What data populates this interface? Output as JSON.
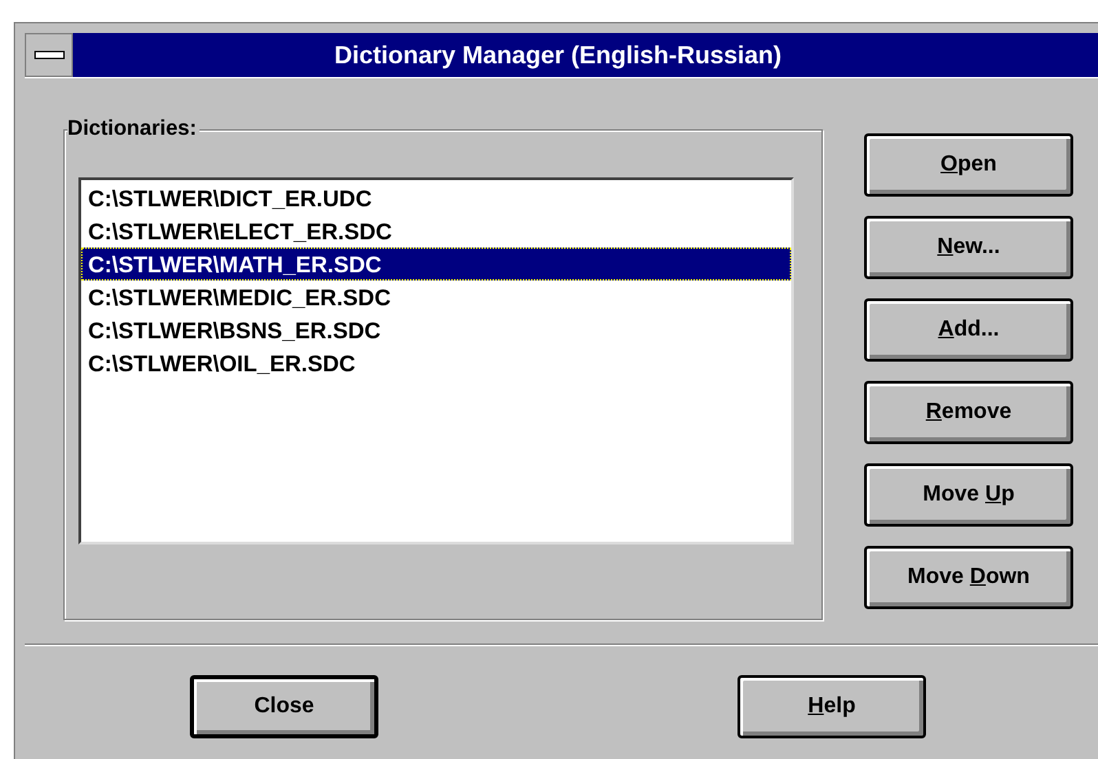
{
  "window": {
    "title": "Dictionary Manager (English-Russian)"
  },
  "dictionaries": {
    "label": "Dictionaries:",
    "items": [
      {
        "text": "C:\\STLWER\\DICT_ER.UDC",
        "selected": false
      },
      {
        "text": "C:\\STLWER\\ELECT_ER.SDC",
        "selected": false
      },
      {
        "text": "C:\\STLWER\\MATH_ER.SDC",
        "selected": true
      },
      {
        "text": "C:\\STLWER\\MEDIC_ER.SDC",
        "selected": false
      },
      {
        "text": "C:\\STLWER\\BSNS_ER.SDC",
        "selected": false
      },
      {
        "text": "C:\\STLWER\\OIL_ER.SDC",
        "selected": false
      }
    ]
  },
  "side_buttons": [
    {
      "label": [
        {
          "text": "O",
          "underline": true
        },
        {
          "text": "pen",
          "underline": false
        }
      ],
      "default": false
    },
    {
      "label": [
        {
          "text": "N",
          "underline": true
        },
        {
          "text": "ew...",
          "underline": false
        }
      ],
      "default": false
    },
    {
      "label": [
        {
          "text": "A",
          "underline": true
        },
        {
          "text": "dd...",
          "underline": false
        }
      ],
      "default": false
    },
    {
      "label": [
        {
          "text": "R",
          "underline": true
        },
        {
          "text": "emove",
          "underline": false
        }
      ],
      "default": false
    },
    {
      "label": [
        {
          "text": "Move ",
          "underline": false
        },
        {
          "text": "U",
          "underline": true
        },
        {
          "text": "p",
          "underline": false
        }
      ],
      "default": false
    },
    {
      "label": [
        {
          "text": "Move ",
          "underline": false
        },
        {
          "text": "D",
          "underline": true
        },
        {
          "text": "own",
          "underline": false
        }
      ],
      "default": false
    }
  ],
  "bottom_buttons": [
    {
      "label": [
        {
          "text": "Close",
          "underline": false
        }
      ],
      "default": true
    },
    {
      "label": [
        {
          "text": "H",
          "underline": true
        },
        {
          "text": "elp",
          "underline": false
        }
      ],
      "default": false
    }
  ]
}
